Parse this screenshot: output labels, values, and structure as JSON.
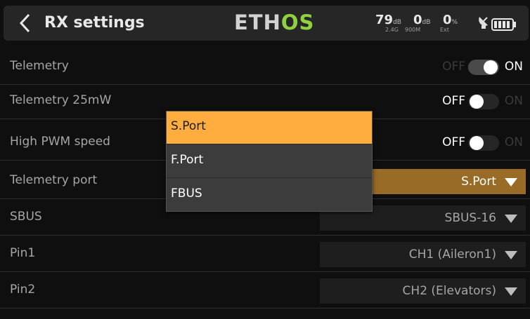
{
  "header": {
    "title": "RX settings",
    "brand_part1": "ETH",
    "brand_part2": "OS",
    "rssi_24": "79",
    "rssi_24_unit": "dB",
    "rssi_900": "0",
    "rssi_900_unit": "dB",
    "ext_pct": "0",
    "ext_unit": "%",
    "sub_24": "2.4G",
    "sub_900": "900M",
    "sub_ext": "Ext",
    "icons": [
      "chevron-left-icon",
      "dish-antenna-icon",
      "battery-icon"
    ]
  },
  "rows": [
    {
      "label": "Telemetry",
      "type": "toggle",
      "off": "OFF",
      "on": "ON",
      "state": true
    },
    {
      "label": "Telemetry 25mW",
      "type": "toggle",
      "off": "OFF",
      "on": "ON",
      "state": false
    },
    {
      "label": "High PWM speed",
      "type": "toggle",
      "off": "OFF",
      "on": "ON",
      "state": false
    },
    {
      "label": "Telemetry port",
      "type": "select",
      "value": "S.Port"
    },
    {
      "label": "SBUS",
      "type": "select",
      "value": "SBUS-16"
    },
    {
      "label": "Pin1",
      "type": "select",
      "value": "CH1 (Aileron1)"
    },
    {
      "label": "Pin2",
      "type": "select",
      "value": "CH2 (Elevators)"
    }
  ],
  "popup": {
    "options": [
      "S.Port",
      "F.Port",
      "FBUS"
    ],
    "selected": "S.Port"
  },
  "colors": {
    "accent": "#ffad3e",
    "active_select": "#986c26",
    "brand_green": "#8fd13f",
    "toggle_on_track": "#4a4a4a",
    "toggle_off_track": "#262626",
    "dim_text": "#3a3a3a"
  }
}
